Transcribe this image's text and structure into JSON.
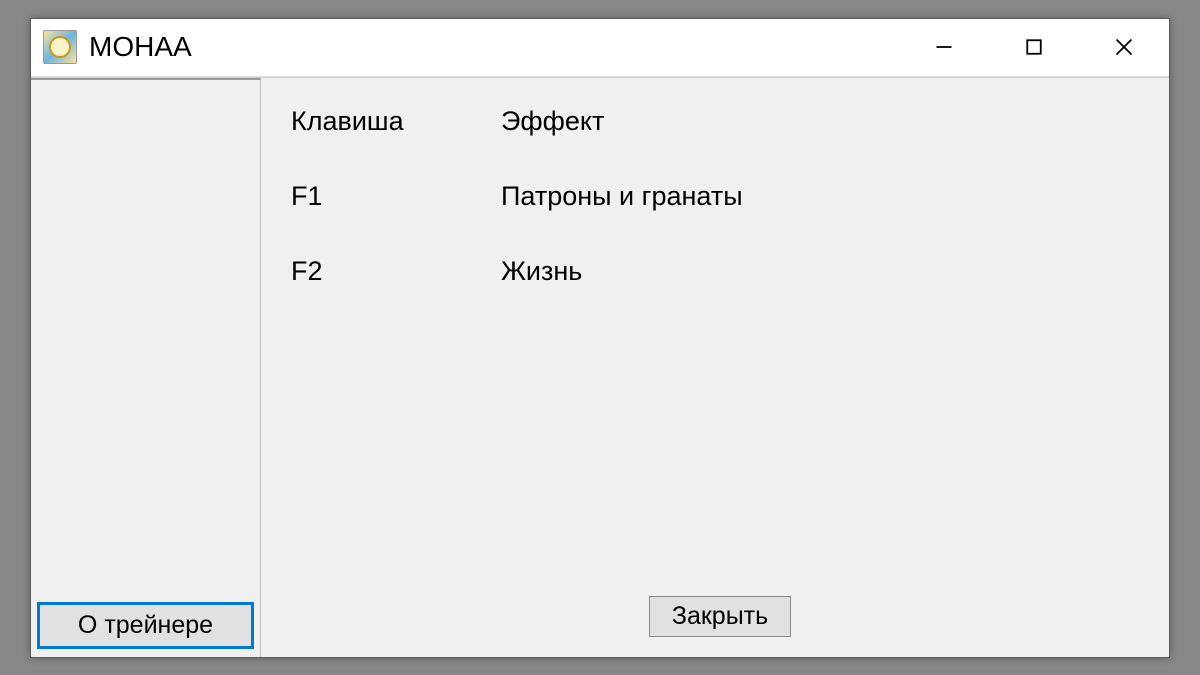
{
  "window": {
    "title": "MOHAA"
  },
  "headers": {
    "key": "Клавиша",
    "effect": "Эффект"
  },
  "rows": [
    {
      "key": "F1",
      "effect": "Патроны и гранаты"
    },
    {
      "key": "F2",
      "effect": "Жизнь"
    }
  ],
  "buttons": {
    "about": "О трейнере",
    "close": "Закрыть"
  }
}
